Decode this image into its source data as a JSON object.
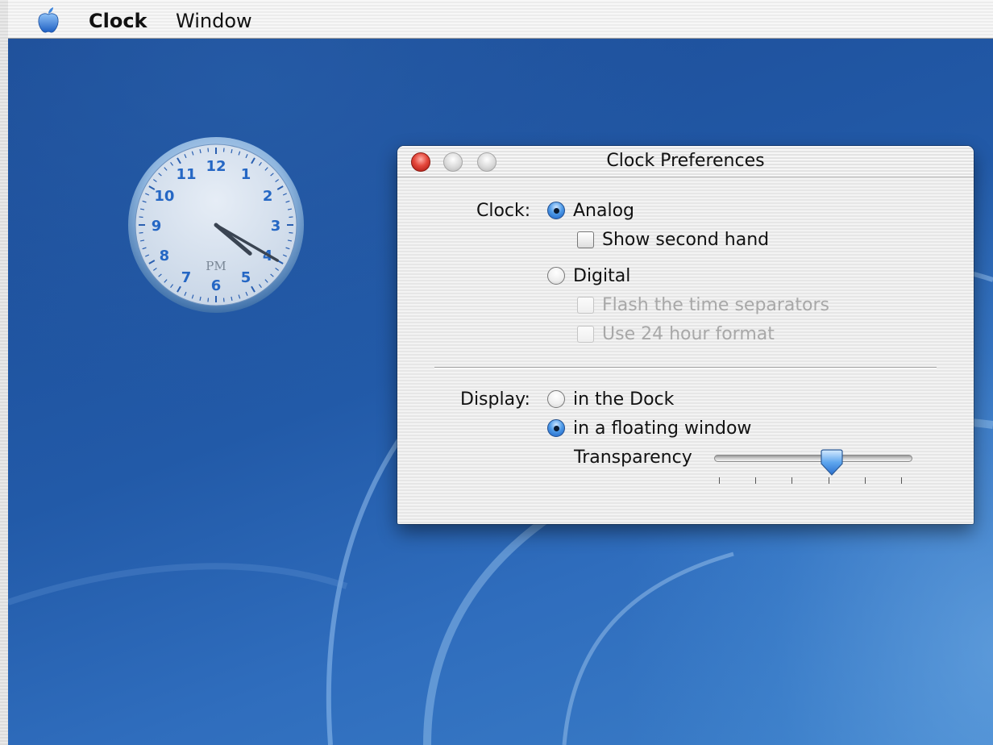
{
  "menubar": {
    "apple_icon": "apple-logo",
    "app_name": "Clock",
    "window_menu": "Window"
  },
  "clock_widget": {
    "numerals": [
      "12",
      "1",
      "2",
      "3",
      "4",
      "5",
      "6",
      "7",
      "8",
      "9",
      "10",
      "11"
    ],
    "period": "PM",
    "time": {
      "hour": 4,
      "minute": 20
    }
  },
  "prefs": {
    "title": "Clock Preferences",
    "clock_label": "Clock:",
    "analog_label": "Analog",
    "analog_selected": true,
    "show_second_hand_label": "Show second hand",
    "show_second_hand_checked": false,
    "digital_label": "Digital",
    "digital_selected": false,
    "flash_separators_label": "Flash the time separators",
    "flash_separators_enabled": false,
    "use_24_hour_label": "Use 24 hour format",
    "use_24_hour_enabled": false,
    "display_label": "Display:",
    "in_dock_label": "in the Dock",
    "in_dock_selected": false,
    "floating_window_label": "in a floating window",
    "floating_window_selected": true,
    "transparency_label": "Transparency",
    "transparency_value": 0.6,
    "transparency_ticks": 6
  },
  "colors": {
    "accent_blue": "#2f7fe0",
    "desktop_blue": "#1d4f98",
    "close_red": "#e4483c"
  }
}
